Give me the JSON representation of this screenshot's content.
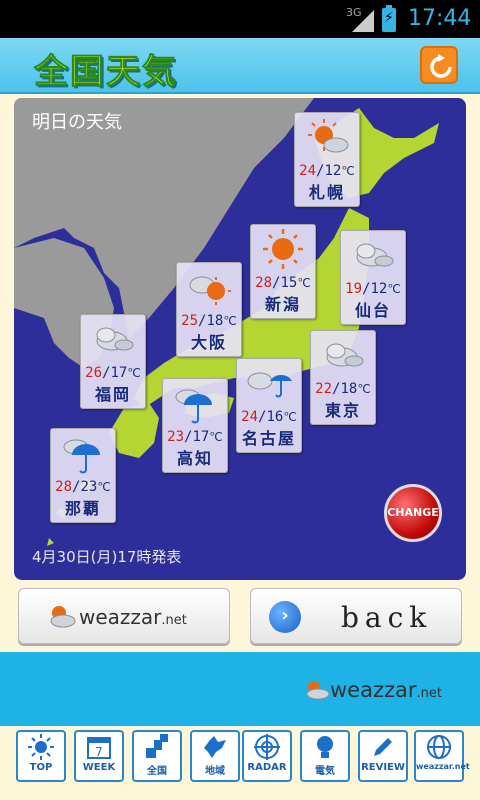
{
  "status": {
    "network": "3G",
    "time": "17:44",
    "battery": "⚡"
  },
  "header": {
    "title": "全国天気",
    "refresh_icon": "refresh-icon"
  },
  "map": {
    "title": "明日の天気",
    "footer": "4月30日(月)17時発表",
    "change_label": "CHANGE",
    "cities": [
      {
        "name": "札幌",
        "hi": "24",
        "lo": "12",
        "unit": "℃",
        "icon": "sunny-cloudy"
      },
      {
        "name": "新潟",
        "hi": "28",
        "lo": "15",
        "unit": "℃",
        "icon": "sunny"
      },
      {
        "name": "仙台",
        "hi": "19",
        "lo": "12",
        "unit": "℃",
        "icon": "cloudy"
      },
      {
        "name": "大阪",
        "hi": "25",
        "lo": "18",
        "unit": "℃",
        "icon": "cloudy-sunny"
      },
      {
        "name": "福岡",
        "hi": "26",
        "lo": "17",
        "unit": "℃",
        "icon": "cloudy"
      },
      {
        "name": "東京",
        "hi": "22",
        "lo": "18",
        "unit": "℃",
        "icon": "cloudy"
      },
      {
        "name": "名古屋",
        "hi": "24",
        "lo": "16",
        "unit": "℃",
        "icon": "cloudy-rain"
      },
      {
        "name": "高知",
        "hi": "23",
        "lo": "17",
        "unit": "℃",
        "icon": "rain"
      },
      {
        "name": "那覇",
        "hi": "28",
        "lo": "23",
        "unit": "℃",
        "icon": "rain"
      }
    ]
  },
  "buttons": {
    "weazzar_brand": "weazzar",
    "weazzar_tld": ".net",
    "back_label": "back"
  },
  "adband": {
    "brand": "weazzar",
    "tld": ".net"
  },
  "nav": [
    {
      "label": "TOP",
      "icon": "sun-icon"
    },
    {
      "label": "WEEK",
      "icon": "calendar-icon",
      "badge": "7"
    },
    {
      "label": "全国",
      "icon": "map-icon"
    },
    {
      "label": "地域",
      "icon": "hokkaido-icon"
    },
    {
      "label": "RADAR",
      "icon": "radar-icon"
    },
    {
      "label": "電気",
      "icon": "bulb-icon"
    },
    {
      "label": "REVIEW",
      "icon": "pencil-icon"
    },
    {
      "label": "weazzar.net",
      "icon": "globe-icon"
    }
  ],
  "colors": {
    "accent": "#35b5e5",
    "sea": "#2e2e9a",
    "land": "#b5d632",
    "hi": "#cc2020",
    "lo": "#1a2a7a"
  }
}
